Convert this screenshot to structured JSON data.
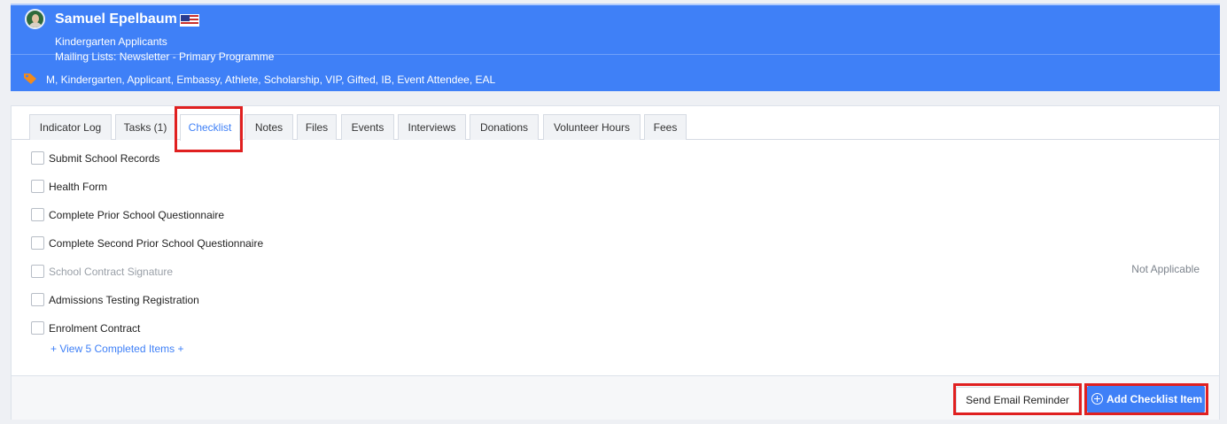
{
  "header": {
    "name": "Samuel Epelbaum",
    "flag": "us-flag-icon",
    "line1": "Kindergarten Applicants",
    "line2": "Mailing Lists: Newsletter - Primary Programme",
    "tags": "M, Kindergarten, Applicant, Embassy, Athlete, Scholarship, VIP, Gifted, IB, Event Attendee, EAL",
    "accent": "#3f80f7",
    "tag_icon_color": "#f28a1b"
  },
  "tabs": [
    {
      "label": "Indicator Log"
    },
    {
      "label": "Tasks (1)"
    },
    {
      "label": "Checklist",
      "active": true
    },
    {
      "label": "Notes"
    },
    {
      "label": "Files"
    },
    {
      "label": "Events"
    },
    {
      "label": "Interviews"
    },
    {
      "label": "Donations"
    },
    {
      "label": "Volunteer Hours"
    },
    {
      "label": "Fees"
    }
  ],
  "checklist": {
    "items": [
      {
        "label": "Submit School Records",
        "checked": false
      },
      {
        "label": "Health Form",
        "checked": false
      },
      {
        "label": "Complete Prior School Questionnaire",
        "checked": false
      },
      {
        "label": "Complete Second Prior School Questionnaire",
        "checked": false
      },
      {
        "label": "School Contract Signature",
        "checked": false,
        "status": "Not Applicable"
      },
      {
        "label": "Admissions Testing Registration",
        "checked": false
      },
      {
        "label": "Enrolment Contract",
        "checked": false
      }
    ],
    "view_completed": "+ View 5 Completed Items +"
  },
  "footer": {
    "email_button": "Send Email Reminder",
    "add_button": "Add Checklist Item"
  },
  "highlight_color": "#e02020"
}
